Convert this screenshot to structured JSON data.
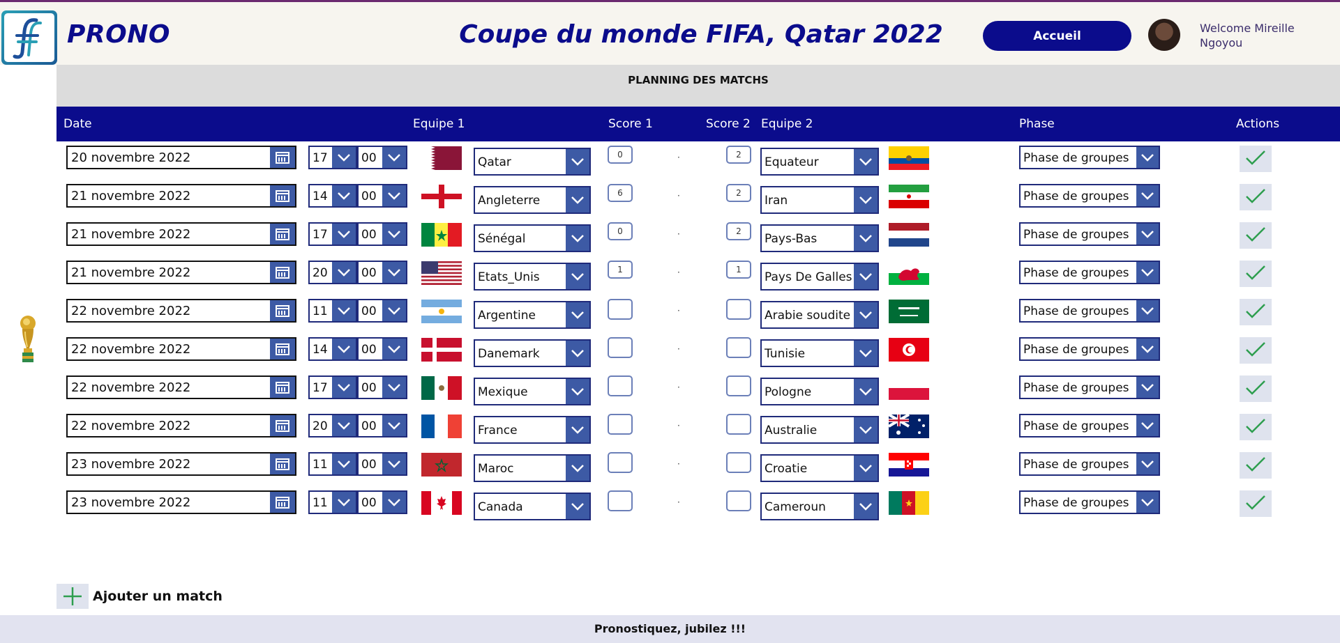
{
  "header": {
    "brand": "PRONO",
    "title": "Coupe du monde FIFA, Qatar 2022",
    "home_button": "Accueil",
    "welcome": "Welcome Mireille Ngoyou"
  },
  "section_title": "PLANNING DES MATCHS",
  "columns": {
    "date": "Date",
    "team1": "Equipe 1",
    "score1": "Score 1",
    "score2": "Score 2",
    "team2": "Equipe 2",
    "phase": "Phase",
    "actions": "Actions"
  },
  "matches": [
    {
      "date": "20 novembre 2022",
      "hour": "17",
      "minute": "00",
      "team1": "Qatar",
      "flag1": "qatar-flag-icon",
      "score1": "0",
      "score2": "2",
      "team2": "Equateur",
      "flag2": "ecuador-flag-icon",
      "phase": "Phase de groupes"
    },
    {
      "date": "21 novembre 2022",
      "hour": "14",
      "minute": "00",
      "team1": "Angleterre",
      "flag1": "england-flag-icon",
      "score1": "6",
      "score2": "2",
      "team2": "Iran",
      "flag2": "iran-flag-icon",
      "phase": "Phase de groupes"
    },
    {
      "date": "21 novembre 2022",
      "hour": "17",
      "minute": "00",
      "team1": "Sénégal",
      "flag1": "senegal-flag-icon",
      "score1": "0",
      "score2": "2",
      "team2": "Pays-Bas",
      "flag2": "netherlands-flag-icon",
      "phase": "Phase de groupes"
    },
    {
      "date": "21 novembre 2022",
      "hour": "20",
      "minute": "00",
      "team1": "Etats_Unis",
      "flag1": "usa-flag-icon",
      "score1": "1",
      "score2": "1",
      "team2": "Pays De Galles",
      "flag2": "wales-flag-icon",
      "phase": "Phase de groupes"
    },
    {
      "date": "22 novembre 2022",
      "hour": "11",
      "minute": "00",
      "team1": "Argentine",
      "flag1": "argentina-flag-icon",
      "score1": "",
      "score2": "",
      "team2": "Arabie soudite",
      "flag2": "saudi-arabia-flag-icon",
      "phase": "Phase de groupes"
    },
    {
      "date": "22 novembre 2022",
      "hour": "14",
      "minute": "00",
      "team1": "Danemark",
      "flag1": "denmark-flag-icon",
      "score1": "",
      "score2": "",
      "team2": "Tunisie",
      "flag2": "tunisia-flag-icon",
      "phase": "Phase de groupes"
    },
    {
      "date": "22 novembre 2022",
      "hour": "17",
      "minute": "00",
      "team1": "Mexique",
      "flag1": "mexico-flag-icon",
      "score1": "",
      "score2": "",
      "team2": "Pologne",
      "flag2": "poland-flag-icon",
      "phase": "Phase de groupes"
    },
    {
      "date": "22 novembre 2022",
      "hour": "20",
      "minute": "00",
      "team1": "France",
      "flag1": "france-flag-icon",
      "score1": "",
      "score2": "",
      "team2": "Australie",
      "flag2": "australia-flag-icon",
      "phase": "Phase de groupes"
    },
    {
      "date": "23 novembre 2022",
      "hour": "11",
      "minute": "00",
      "team1": "Maroc",
      "flag1": "morocco-flag-icon",
      "score1": "",
      "score2": "",
      "team2": "Croatie",
      "flag2": "croatia-flag-icon",
      "phase": "Phase de groupes"
    },
    {
      "date": "23 novembre 2022",
      "hour": "11",
      "minute": "00",
      "team1": "Canada",
      "flag1": "canada-flag-icon",
      "score1": "",
      "score2": "",
      "team2": "Cameroun",
      "flag2": "cameroon-flag-icon",
      "phase": "Phase de groupes"
    }
  ],
  "add_match_label": "Ajouter un match",
  "footer": "Pronostiquez, jubilez !!!",
  "colors": {
    "primary": "#0b0c8c",
    "control": "#3d5aa5",
    "check": "#2e9e4f"
  }
}
